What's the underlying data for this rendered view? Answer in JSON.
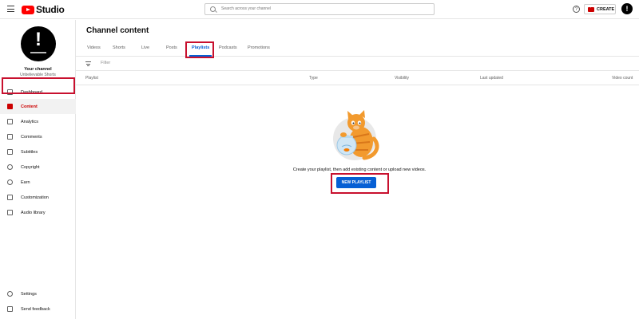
{
  "app": {
    "logo_text": "Studio"
  },
  "search": {
    "placeholder": "Search across your channel"
  },
  "header": {
    "help_icon": "?",
    "create_label": "CREATE",
    "avatar_glyph": "!"
  },
  "channel": {
    "avatar_glyph": "!",
    "title": "Your channel",
    "handle": "Unbelievable Shorts"
  },
  "sidebar": {
    "items": [
      {
        "label": "Dashboard",
        "icon": "dashboard-icon"
      },
      {
        "label": "Content",
        "icon": "content-icon",
        "active": true
      },
      {
        "label": "Analytics",
        "icon": "analytics-icon"
      },
      {
        "label": "Comments",
        "icon": "comments-icon"
      },
      {
        "label": "Subtitles",
        "icon": "subtitles-icon"
      },
      {
        "label": "Copyright",
        "icon": "copyright-icon"
      },
      {
        "label": "Earn",
        "icon": "earn-icon"
      },
      {
        "label": "Customization",
        "icon": "customization-icon"
      },
      {
        "label": "Audio library",
        "icon": "audio-library-icon"
      }
    ],
    "bottom": [
      {
        "label": "Settings",
        "icon": "gear-icon"
      },
      {
        "label": "Send feedback",
        "icon": "feedback-icon"
      }
    ]
  },
  "main": {
    "title": "Channel content",
    "tabs": [
      "Videos",
      "Shorts",
      "Live",
      "Posts",
      "Playlists",
      "Podcasts",
      "Promotions"
    ],
    "active_tab": "Playlists",
    "filter_label": "Filter",
    "columns": [
      "Playlist",
      "Type",
      "Visibility",
      "Last updated",
      "Video count"
    ],
    "empty_message": "Create your playlist, then add existing content or upload new videos.",
    "new_playlist_label": "NEW PLAYLIST"
  },
  "colors": {
    "brand_red": "#ff0000",
    "accent_blue": "#065fd4",
    "highlight_red": "#c8102e"
  }
}
